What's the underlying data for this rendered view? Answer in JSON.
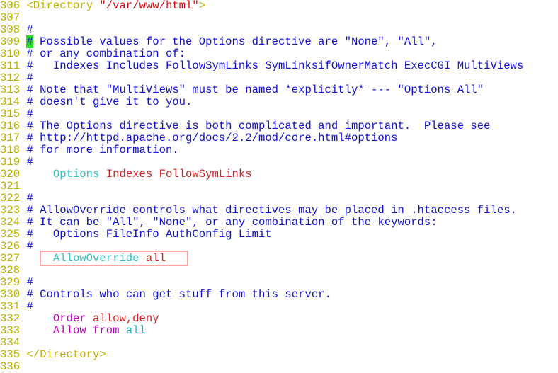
{
  "editor": {
    "colors": {
      "line_number": "#b8b000",
      "comment": "#1010d0",
      "directive": "#30c0c0",
      "value": "#d02020",
      "cursor": "#20e020",
      "highlight_box": "#f4a8a8"
    },
    "cursor_line": "309",
    "highlighted_line": "327",
    "lines": [
      {
        "n": "306",
        "segs": [
          {
            "t": "<Directory ",
            "c": "tag"
          },
          {
            "t": "\"/var/www/html\"",
            "c": "str"
          },
          {
            "t": ">",
            "c": "tag"
          }
        ]
      },
      {
        "n": "307",
        "segs": []
      },
      {
        "n": "308",
        "segs": [
          {
            "t": "#",
            "c": "cmt"
          }
        ]
      },
      {
        "n": "309",
        "segs": [
          {
            "t": "#",
            "c": "cursor"
          },
          {
            "t": " Possible values for the Options directive are \"None\", \"All\",",
            "c": "cmt"
          }
        ]
      },
      {
        "n": "310",
        "segs": [
          {
            "t": "# or any combination of:",
            "c": "cmt"
          }
        ]
      },
      {
        "n": "311",
        "segs": [
          {
            "t": "#   Indexes Includes FollowSymLinks SymLinksifOwnerMatch ExecCGI MultiViews",
            "c": "cmt"
          }
        ]
      },
      {
        "n": "312",
        "segs": [
          {
            "t": "#",
            "c": "cmt"
          }
        ]
      },
      {
        "n": "313",
        "segs": [
          {
            "t": "# Note that \"MultiViews\" must be named *explicitly* --- \"Options All\"",
            "c": "cmt"
          }
        ]
      },
      {
        "n": "314",
        "segs": [
          {
            "t": "# doesn't give it to you.",
            "c": "cmt"
          }
        ]
      },
      {
        "n": "315",
        "segs": [
          {
            "t": "#",
            "c": "cmt"
          }
        ]
      },
      {
        "n": "316",
        "segs": [
          {
            "t": "# The Options directive is both complicated and important.  Please see",
            "c": "cmt"
          }
        ]
      },
      {
        "n": "317",
        "segs": [
          {
            "t": "# http://httpd.apache.org/docs/2.2/mod/core.html#options",
            "c": "cmt"
          }
        ]
      },
      {
        "n": "318",
        "segs": [
          {
            "t": "# for more information.",
            "c": "cmt"
          }
        ]
      },
      {
        "n": "319",
        "segs": [
          {
            "t": "#",
            "c": "cmt"
          }
        ]
      },
      {
        "n": "320",
        "segs": [
          {
            "t": "    ",
            "c": ""
          },
          {
            "t": "Options ",
            "c": "kw"
          },
          {
            "t": "Indexes FollowSymLinks",
            "c": "val"
          }
        ]
      },
      {
        "n": "321",
        "segs": []
      },
      {
        "n": "322",
        "segs": [
          {
            "t": "#",
            "c": "cmt"
          }
        ]
      },
      {
        "n": "323",
        "segs": [
          {
            "t": "# AllowOverride controls what directives may be placed in .htaccess files.",
            "c": "cmt"
          }
        ]
      },
      {
        "n": "324",
        "segs": [
          {
            "t": "# It can be \"All\", \"None\", or any combination of the keywords:",
            "c": "cmt"
          }
        ]
      },
      {
        "n": "325",
        "segs": [
          {
            "t": "#   Options FileInfo AuthConfig Limit",
            "c": "cmt"
          }
        ]
      },
      {
        "n": "326",
        "segs": [
          {
            "t": "#",
            "c": "cmt"
          }
        ]
      },
      {
        "n": "327",
        "segs": [
          {
            "t": "    ",
            "c": ""
          },
          {
            "t": "AllowOverride ",
            "c": "kw"
          },
          {
            "t": "all",
            "c": "val"
          }
        ]
      },
      {
        "n": "328",
        "segs": []
      },
      {
        "n": "329",
        "segs": [
          {
            "t": "#",
            "c": "cmt"
          }
        ]
      },
      {
        "n": "330",
        "segs": [
          {
            "t": "# Controls who can get stuff from this server.",
            "c": "cmt"
          }
        ]
      },
      {
        "n": "331",
        "segs": [
          {
            "t": "#",
            "c": "cmt"
          }
        ]
      },
      {
        "n": "332",
        "segs": [
          {
            "t": "    ",
            "c": ""
          },
          {
            "t": "Order ",
            "c": "mag"
          },
          {
            "t": "allow,deny",
            "c": "val"
          }
        ]
      },
      {
        "n": "333",
        "segs": [
          {
            "t": "    ",
            "c": ""
          },
          {
            "t": "Allow from ",
            "c": "mag"
          },
          {
            "t": "all",
            "c": "cyan"
          }
        ]
      },
      {
        "n": "334",
        "segs": []
      },
      {
        "n": "335",
        "segs": [
          {
            "t": "</Directory>",
            "c": "tag"
          }
        ]
      },
      {
        "n": "336",
        "segs": []
      }
    ]
  }
}
